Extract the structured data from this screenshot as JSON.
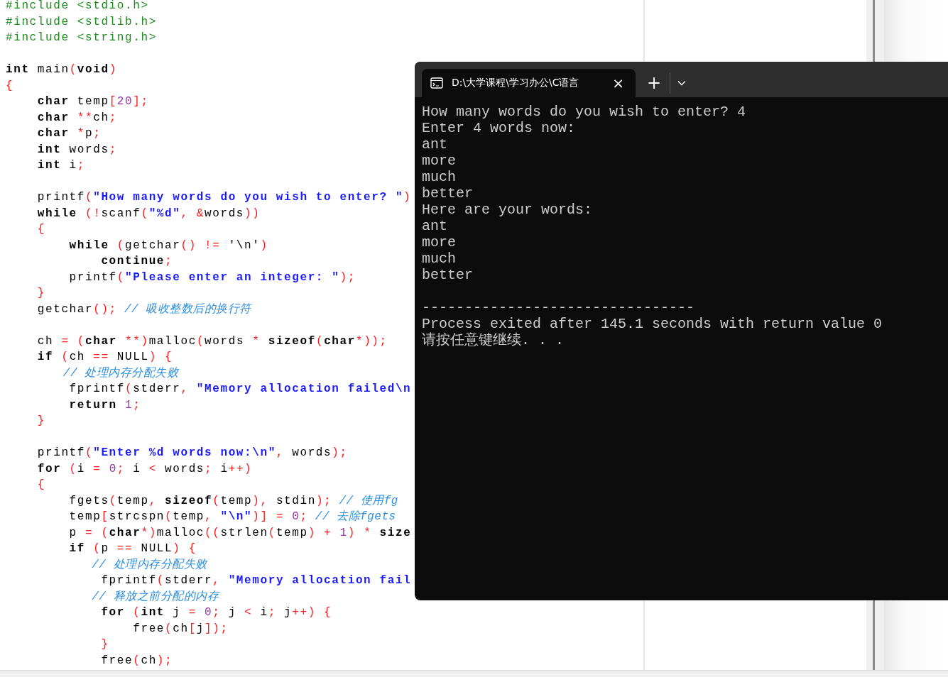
{
  "editor": {
    "blocks": [
      [
        [
          {
            "text": "#include <stdio.h>",
            "kind": "pre"
          }
        ],
        [
          {
            "text": "#include <stdlib.h>",
            "kind": "pre"
          }
        ],
        [
          {
            "text": "#include <string.h>",
            "kind": "pre"
          }
        ]
      ],
      [
        [
          {
            "text": "int",
            "kind": "kw"
          },
          {
            "text": " main",
            "kind": "id"
          },
          {
            "text": "(",
            "kind": "op"
          },
          {
            "text": "void",
            "kind": "kw"
          },
          {
            "text": ")",
            "kind": "op"
          }
        ],
        [
          {
            "text": "{",
            "kind": "op"
          }
        ],
        [
          {
            "text": "    char",
            "kind": "kw"
          },
          {
            "text": " temp",
            "kind": "id"
          },
          {
            "text": "[",
            "kind": "op"
          },
          {
            "text": "20",
            "kind": "num"
          },
          {
            "text": "];",
            "kind": "op"
          }
        ],
        [
          {
            "text": "    char ",
            "kind": "kw"
          },
          {
            "text": "**",
            "kind": "op"
          },
          {
            "text": "ch",
            "kind": "id"
          },
          {
            "text": ";",
            "kind": "op"
          }
        ],
        [
          {
            "text": "    char ",
            "kind": "kw"
          },
          {
            "text": "*",
            "kind": "op"
          },
          {
            "text": "p",
            "kind": "id"
          },
          {
            "text": ";",
            "kind": "op"
          }
        ],
        [
          {
            "text": "    int",
            "kind": "kw"
          },
          {
            "text": " words",
            "kind": "id"
          },
          {
            "text": ";",
            "kind": "op"
          }
        ],
        [
          {
            "text": "    int",
            "kind": "kw"
          },
          {
            "text": " i",
            "kind": "id"
          },
          {
            "text": ";",
            "kind": "op"
          }
        ]
      ],
      [
        [
          {
            "text": "    printf",
            "kind": "id"
          },
          {
            "text": "(",
            "kind": "op"
          },
          {
            "text": "\"How many words do you wish to enter? \"",
            "kind": "str"
          },
          {
            "text": ")",
            "kind": "op"
          }
        ],
        [
          {
            "text": "    while ",
            "kind": "kw"
          },
          {
            "text": "(!",
            "kind": "op"
          },
          {
            "text": "scanf",
            "kind": "id"
          },
          {
            "text": "(",
            "kind": "op"
          },
          {
            "text": "\"%d\"",
            "kind": "str"
          },
          {
            "text": ", &",
            "kind": "op"
          },
          {
            "text": "words",
            "kind": "id"
          },
          {
            "text": "))",
            "kind": "op"
          }
        ],
        [
          {
            "text": "    {",
            "kind": "op"
          }
        ],
        [
          {
            "text": "        while ",
            "kind": "kw"
          },
          {
            "text": "(",
            "kind": "op"
          },
          {
            "text": "getchar",
            "kind": "id"
          },
          {
            "text": "() != ",
            "kind": "op"
          },
          {
            "text": "'\\n'",
            "kind": "id"
          },
          {
            "text": ")",
            "kind": "op"
          }
        ],
        [
          {
            "text": "            continue",
            "kind": "kw"
          },
          {
            "text": ";",
            "kind": "op"
          }
        ],
        [
          {
            "text": "        printf",
            "kind": "id"
          },
          {
            "text": "(",
            "kind": "op"
          },
          {
            "text": "\"Please enter an integer: \"",
            "kind": "str"
          },
          {
            "text": ");",
            "kind": "op"
          }
        ],
        [
          {
            "text": "    }",
            "kind": "op"
          }
        ],
        [
          {
            "text": "    getchar",
            "kind": "id"
          },
          {
            "text": "();",
            "kind": "op"
          },
          {
            "text": " // 吸收整数后的换行符",
            "kind": "cm"
          }
        ]
      ],
      [
        [
          {
            "text": "    ch",
            "kind": "id"
          },
          {
            "text": " = (",
            "kind": "op"
          },
          {
            "text": "char",
            "kind": "kw"
          },
          {
            "text": " **)",
            "kind": "op"
          },
          {
            "text": "malloc",
            "kind": "id"
          },
          {
            "text": "(",
            "kind": "op"
          },
          {
            "text": "words",
            "kind": "id"
          },
          {
            "text": " * ",
            "kind": "op"
          },
          {
            "text": "sizeof",
            "kind": "kw"
          },
          {
            "text": "(",
            "kind": "op"
          },
          {
            "text": "char",
            "kind": "kw"
          },
          {
            "text": "*));",
            "kind": "op"
          }
        ],
        [
          {
            "text": "    if",
            "kind": "kw"
          },
          {
            "text": " (",
            "kind": "op"
          },
          {
            "text": "ch",
            "kind": "id"
          },
          {
            "text": " == ",
            "kind": "op"
          },
          {
            "text": "NULL",
            "kind": "id"
          },
          {
            "text": ") {",
            "kind": "op"
          }
        ],
        [
          {
            "text": "        // 处理内存分配失败",
            "kind": "cm"
          }
        ],
        [
          {
            "text": "        fprintf",
            "kind": "id"
          },
          {
            "text": "(",
            "kind": "op"
          },
          {
            "text": "stderr",
            "kind": "id"
          },
          {
            "text": ", ",
            "kind": "op"
          },
          {
            "text": "\"Memory allocation failed\\n",
            "kind": "str"
          }
        ],
        [
          {
            "text": "        return",
            "kind": "kw"
          },
          {
            "text": " 1",
            "kind": "num"
          },
          {
            "text": ";",
            "kind": "op"
          }
        ],
        [
          {
            "text": "    }",
            "kind": "op"
          }
        ]
      ],
      [
        [
          {
            "text": "    printf",
            "kind": "id"
          },
          {
            "text": "(",
            "kind": "op"
          },
          {
            "text": "\"Enter %d words now:\\n\"",
            "kind": "str"
          },
          {
            "text": ", ",
            "kind": "op"
          },
          {
            "text": "words",
            "kind": "id"
          },
          {
            "text": ");",
            "kind": "op"
          }
        ],
        [
          {
            "text": "    for",
            "kind": "kw"
          },
          {
            "text": " (",
            "kind": "op"
          },
          {
            "text": "i",
            "kind": "id"
          },
          {
            "text": " = ",
            "kind": "op"
          },
          {
            "text": "0",
            "kind": "num"
          },
          {
            "text": "; ",
            "kind": "op"
          },
          {
            "text": "i",
            "kind": "id"
          },
          {
            "text": " < ",
            "kind": "op"
          },
          {
            "text": "words",
            "kind": "id"
          },
          {
            "text": "; ",
            "kind": "op"
          },
          {
            "text": "i",
            "kind": "id"
          },
          {
            "text": "++)",
            "kind": "op"
          }
        ],
        [
          {
            "text": "    {",
            "kind": "op"
          }
        ],
        [
          {
            "text": "        fgets",
            "kind": "id"
          },
          {
            "text": "(",
            "kind": "op"
          },
          {
            "text": "temp",
            "kind": "id"
          },
          {
            "text": ", ",
            "kind": "op"
          },
          {
            "text": "sizeof",
            "kind": "kw"
          },
          {
            "text": "(",
            "kind": "op"
          },
          {
            "text": "temp",
            "kind": "id"
          },
          {
            "text": "), ",
            "kind": "op"
          },
          {
            "text": "stdin",
            "kind": "id"
          },
          {
            "text": ");",
            "kind": "op"
          },
          {
            "text": " // 使用fg",
            "kind": "cm"
          }
        ],
        [
          {
            "text": "        temp",
            "kind": "id"
          },
          {
            "text": "[",
            "kind": "op"
          },
          {
            "text": "strcspn",
            "kind": "id"
          },
          {
            "text": "(",
            "kind": "op"
          },
          {
            "text": "temp",
            "kind": "id"
          },
          {
            "text": ", ",
            "kind": "op"
          },
          {
            "text": "\"\\n\"",
            "kind": "str"
          },
          {
            "text": ")] = ",
            "kind": "op"
          },
          {
            "text": "0",
            "kind": "num"
          },
          {
            "text": ";",
            "kind": "op"
          },
          {
            "text": " // 去除fgets",
            "kind": "cm"
          }
        ],
        [
          {
            "text": "        p",
            "kind": "id"
          },
          {
            "text": " = (",
            "kind": "op"
          },
          {
            "text": "char",
            "kind": "kw"
          },
          {
            "text": "*)",
            "kind": "op"
          },
          {
            "text": "malloc",
            "kind": "id"
          },
          {
            "text": "((",
            "kind": "op"
          },
          {
            "text": "strlen",
            "kind": "id"
          },
          {
            "text": "(",
            "kind": "op"
          },
          {
            "text": "temp",
            "kind": "id"
          },
          {
            "text": ") + ",
            "kind": "op"
          },
          {
            "text": "1",
            "kind": "num"
          },
          {
            "text": ") * ",
            "kind": "op"
          },
          {
            "text": "size",
            "kind": "kw"
          }
        ],
        [
          {
            "text": "        if",
            "kind": "kw"
          },
          {
            "text": " (",
            "kind": "op"
          },
          {
            "text": "p",
            "kind": "id"
          },
          {
            "text": " == ",
            "kind": "op"
          },
          {
            "text": "NULL",
            "kind": "id"
          },
          {
            "text": ") {",
            "kind": "op"
          }
        ],
        [
          {
            "text": "            // 处理内存分配失败",
            "kind": "cm"
          }
        ],
        [
          {
            "text": "            fprintf",
            "kind": "id"
          },
          {
            "text": "(",
            "kind": "op"
          },
          {
            "text": "stderr",
            "kind": "id"
          },
          {
            "text": ", ",
            "kind": "op"
          },
          {
            "text": "\"Memory allocation fail",
            "kind": "str"
          }
        ],
        [
          {
            "text": "            // 释放之前分配的内存",
            "kind": "cm"
          }
        ],
        [
          {
            "text": "            for",
            "kind": "kw"
          },
          {
            "text": " (",
            "kind": "op"
          },
          {
            "text": "int",
            "kind": "kw"
          },
          {
            "text": " j",
            "kind": "id"
          },
          {
            "text": " = ",
            "kind": "op"
          },
          {
            "text": "0",
            "kind": "num"
          },
          {
            "text": "; ",
            "kind": "op"
          },
          {
            "text": "j",
            "kind": "id"
          },
          {
            "text": " < ",
            "kind": "op"
          },
          {
            "text": "i",
            "kind": "id"
          },
          {
            "text": "; ",
            "kind": "op"
          },
          {
            "text": "j",
            "kind": "id"
          },
          {
            "text": "++) {",
            "kind": "op"
          }
        ],
        [
          {
            "text": "                free",
            "kind": "id"
          },
          {
            "text": "(",
            "kind": "op"
          },
          {
            "text": "ch",
            "kind": "id"
          },
          {
            "text": "[",
            "kind": "op"
          },
          {
            "text": "j",
            "kind": "id"
          },
          {
            "text": "]);",
            "kind": "op"
          }
        ],
        [
          {
            "text": "            }",
            "kind": "op"
          }
        ],
        [
          {
            "text": "            free",
            "kind": "id"
          },
          {
            "text": "(",
            "kind": "op"
          },
          {
            "text": "ch",
            "kind": "id"
          },
          {
            "text": ");",
            "kind": "op"
          }
        ]
      ]
    ]
  },
  "terminal": {
    "tab": {
      "title": "D:\\大学课程\\学习办公\\C语言",
      "close": "×"
    },
    "new_tab": "+",
    "output": [
      [
        "How many words do you wish to enter? 4",
        "Enter 4 words now:",
        "ant",
        "more",
        "much",
        "better",
        "Here are your words:",
        "ant",
        "more",
        "much",
        "better"
      ],
      [
        "--------------------------------",
        "Process exited after 145.1 seconds with return value 0",
        "请按任意键继续. . ."
      ]
    ]
  }
}
